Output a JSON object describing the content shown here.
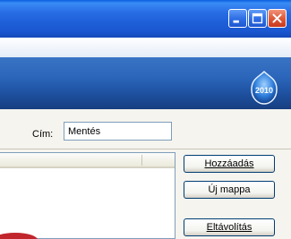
{
  "window": {
    "controls": [
      "minimize-icon",
      "maximize-icon",
      "close-icon"
    ],
    "accent_color": "#1e5fd8",
    "close_color": "#df5a3a"
  },
  "banner": {
    "logo_text": "2010"
  },
  "form": {
    "title_label": "Cím:",
    "title_value": "Mentés"
  },
  "buttons": {
    "add_label": "Hozzáadás",
    "new_folder_label": "Új mappa",
    "remove_label": "Eltávolítás"
  }
}
